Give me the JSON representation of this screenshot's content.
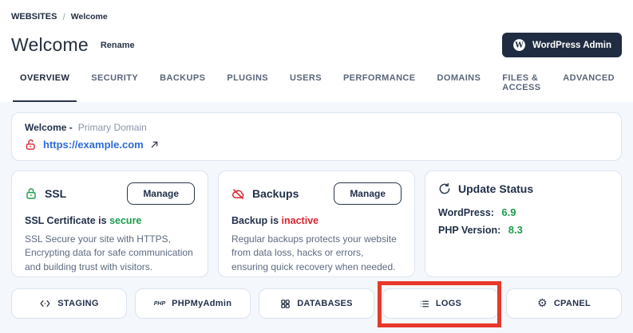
{
  "breadcrumb": {
    "root": "WEBSITES",
    "separator": "/",
    "current": "Welcome"
  },
  "header": {
    "title": "Welcome",
    "rename_label": "Rename",
    "wordpress_admin_label": "WordPress Admin"
  },
  "tabs": [
    {
      "label": "OVERVIEW",
      "active": true
    },
    {
      "label": "SECURITY",
      "active": false
    },
    {
      "label": "BACKUPS",
      "active": false
    },
    {
      "label": "PLUGINS",
      "active": false
    },
    {
      "label": "USERS",
      "active": false
    },
    {
      "label": "PERFORMANCE",
      "active": false
    },
    {
      "label": "DOMAINS",
      "active": false
    },
    {
      "label": "FILES & ACCESS",
      "active": false
    },
    {
      "label": "ADVANCED",
      "active": false
    }
  ],
  "domain_card": {
    "site_name": "Welcome -",
    "domain_label": "Primary Domain",
    "url": "https://example.com"
  },
  "ssl_card": {
    "title": "SSL",
    "manage_label": "Manage",
    "status_prefix": "SSL Certificate is",
    "status_value": "secure",
    "description": "SSL Secure your site with HTTPS, Encrypting data for safe communication and building trust with visitors."
  },
  "backups_card": {
    "title": "Backups",
    "manage_label": "Manage",
    "status_prefix": "Backup is",
    "status_value": "inactive",
    "description": "Regular backups protects your website from data loss, hacks or errors, ensuring quick recovery when needed."
  },
  "update_card": {
    "title": "Update Status",
    "rows": [
      {
        "label": "WordPress:",
        "value": "6.9"
      },
      {
        "label": "PHP Version:",
        "value": "8.3"
      }
    ]
  },
  "quick_actions": [
    {
      "label": "STAGING",
      "icon": "code-brackets-icon"
    },
    {
      "label": "PHPMyAdmin",
      "icon": "php-icon"
    },
    {
      "label": "DATABASES",
      "icon": "grid-icon"
    },
    {
      "label": "LOGS",
      "icon": "list-icon",
      "highlighted": true
    },
    {
      "label": "CPANEL",
      "icon": "gear-icon"
    }
  ],
  "colors": {
    "accent_dark": "#202c41",
    "success_green": "#1b9e4b",
    "danger_red": "#dc2430",
    "link_blue": "#2e6bdb",
    "annotation_red": "#e8382c",
    "card_border": "#dde5f1",
    "page_background": "#f4f7fb"
  }
}
